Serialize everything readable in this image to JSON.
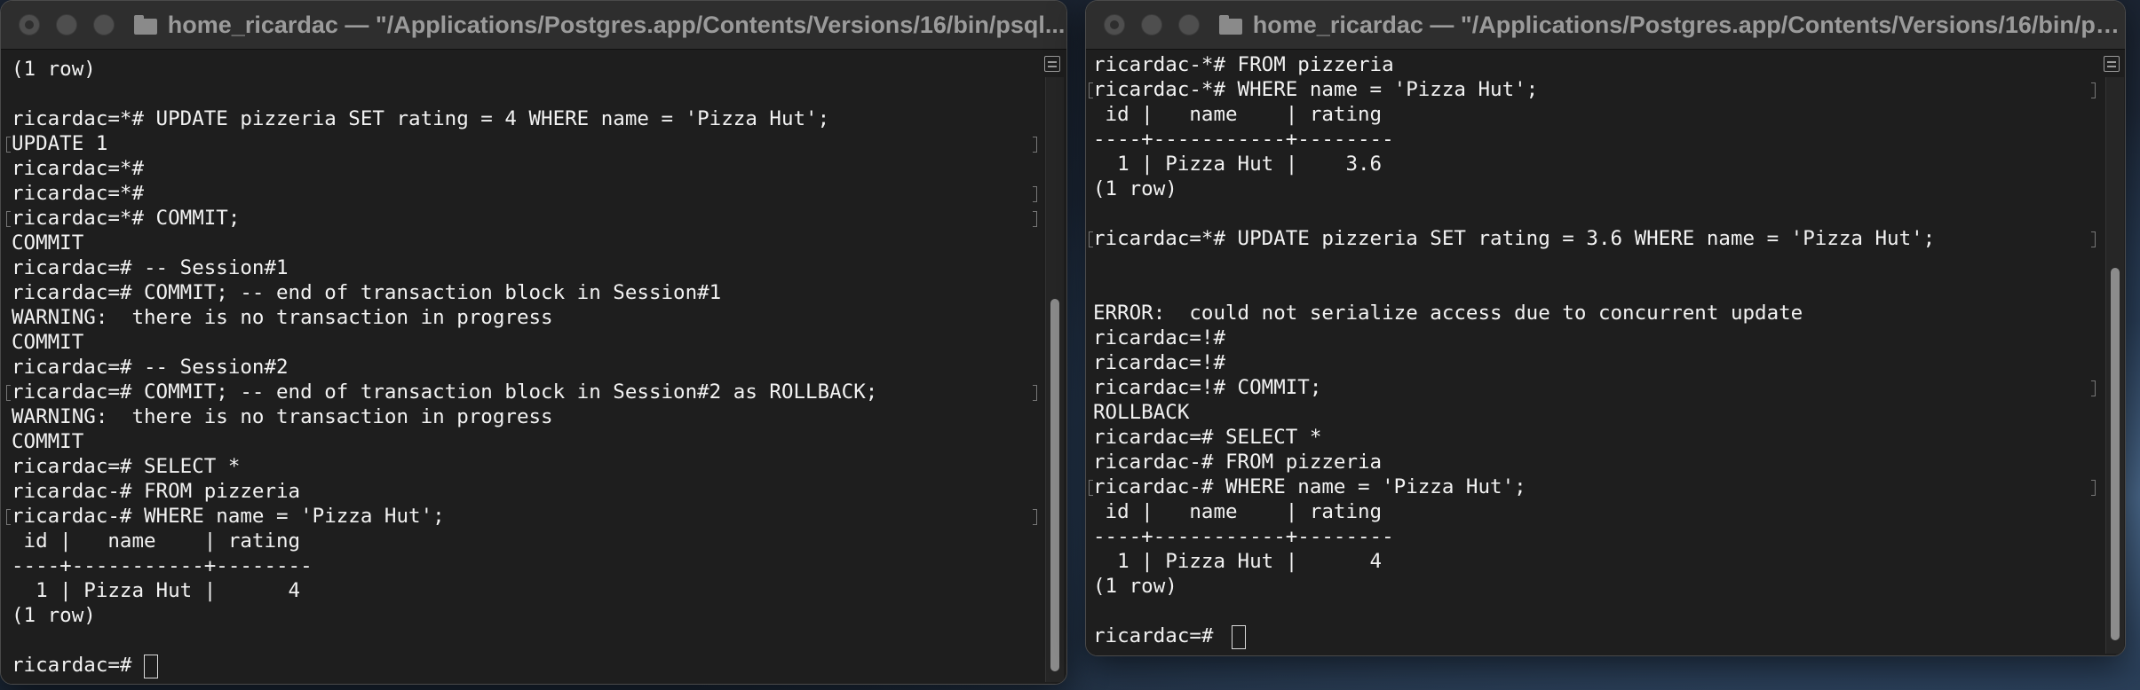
{
  "desktop": {
    "edge_text": "2"
  },
  "window_left": {
    "title": "home_ricardac — \"/Applications/Postgres.app/Contents/Versions/16/bin/psql...",
    "lines": [
      "(1 row)",
      "",
      "ricardac=*# UPDATE pizzeria SET rating = 4 WHERE name = 'Pizza Hut';",
      "UPDATE 1",
      "ricardac=*#",
      "ricardac=*#",
      "ricardac=*# COMMIT;",
      "COMMIT",
      "ricardac=# -- Session#1",
      "ricardac=# COMMIT; -- end of transaction block in Session#1",
      "WARNING:  there is no transaction in progress",
      "COMMIT",
      "ricardac=# -- Session#2",
      "ricardac=# COMMIT; -- end of transaction block in Session#2 as ROLLBACK;",
      "WARNING:  there is no transaction in progress",
      "COMMIT",
      "ricardac=# SELECT *",
      "ricardac-# FROM pizzeria",
      "ricardac-# WHERE name = 'Pizza Hut';",
      " id |   name    | rating",
      "----+-----------+--------",
      "  1 | Pizza Hut |      4",
      "(1 row)",
      "",
      "ricardac=# "
    ]
  },
  "window_right": {
    "title": "home_ricardac — \"/Applications/Postgres.app/Contents/Versions/16/bin/ps...",
    "lines": [
      "ricardac-*# FROM pizzeria",
      "ricardac-*# WHERE name = 'Pizza Hut';",
      " id |   name    | rating",
      "----+-----------+--------",
      "  1 | Pizza Hut |    3.6",
      "(1 row)",
      "",
      "ricardac=*# UPDATE pizzeria SET rating = 3.6 WHERE name = 'Pizza Hut';",
      "",
      "",
      "ERROR:  could not serialize access due to concurrent update",
      "ricardac=!#",
      "ricardac=!#",
      "ricardac=!# COMMIT;",
      "ROLLBACK",
      "ricardac=# SELECT *",
      "ricardac-# FROM pizzeria",
      "ricardac-# WHERE name = 'Pizza Hut';",
      " id |   name    | rating",
      "----+-----------+--------",
      "  1 | Pizza Hut |      4",
      "(1 row)",
      "",
      "ricardac=# "
    ]
  }
}
